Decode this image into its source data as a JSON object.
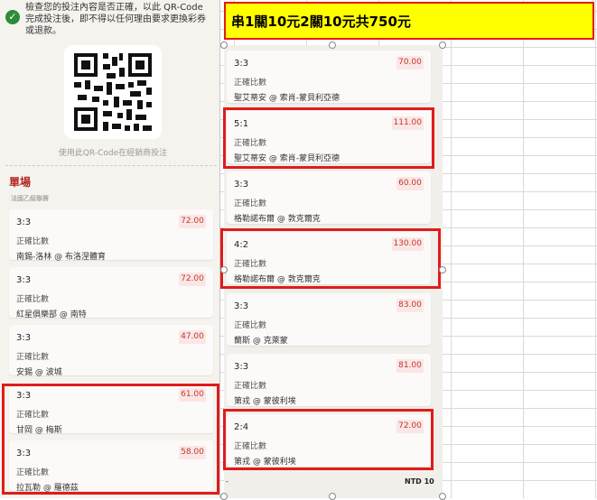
{
  "notice": {
    "text": "檢查您的投注內容是否正確，以此 QR-Code 完成投注後，即不得以任何理由要求更換彩券或退款。"
  },
  "qr_caption": "使用此QR-Code在經銷商投注",
  "section": {
    "title": "單場",
    "subtitle": "法國乙級聯賽"
  },
  "left_cards": [
    {
      "score": "3:3",
      "odds": "72.00",
      "market": "正確比數",
      "match": "南錫-洛林 @ 布洛涅體育"
    },
    {
      "score": "3:3",
      "odds": "72.00",
      "market": "正確比數",
      "match": "紅星俱樂部 @ 南特"
    },
    {
      "score": "3:3",
      "odds": "47.00",
      "market": "正確比數",
      "match": "安錫 @ 波城"
    },
    {
      "score": "3:3",
      "odds": "61.00",
      "market": "正確比數",
      "match": "甘岡 @ 梅斯"
    },
    {
      "score": "3:3",
      "odds": "58.00",
      "market": "正確比數",
      "match": "拉瓦勒 @ 羅德茲"
    }
  ],
  "right_cards": [
    {
      "score": "3:3",
      "odds": "70.00",
      "market": "正確比數",
      "match": "聖艾蒂安 @ 索肖-蒙貝利亞德"
    },
    {
      "score": "5:1",
      "odds": "111.00",
      "market": "正確比數",
      "match": "聖艾蒂安 @ 索肖-蒙貝利亞德"
    },
    {
      "score": "3:3",
      "odds": "60.00",
      "market": "正確比數",
      "match": "格勒諾布爾 @ 敦克爾克"
    },
    {
      "score": "4:2",
      "odds": "130.00",
      "market": "正確比數",
      "match": "格勒諾布爾 @ 敦克爾克"
    },
    {
      "score": "3:3",
      "odds": "83.00",
      "market": "正確比數",
      "match": "蘭斯 @ 克萊蒙"
    },
    {
      "score": "3:3",
      "odds": "81.00",
      "market": "正確比數",
      "match": "第戎 @ 蒙彼利埃"
    },
    {
      "score": "2:4",
      "odds": "72.00",
      "market": "正確比數",
      "match": "第戎 @ 蒙彼利埃"
    }
  ],
  "annotation": {
    "text": "串1關10元2關10元共750元"
  },
  "footer": {
    "left": "-",
    "right": "NTD 10"
  },
  "colors": {
    "highlight_border": "#e11b1b",
    "annotation_fill": "#ffff00",
    "odds_text": "#c0392b",
    "success": "#2e8b3a"
  }
}
